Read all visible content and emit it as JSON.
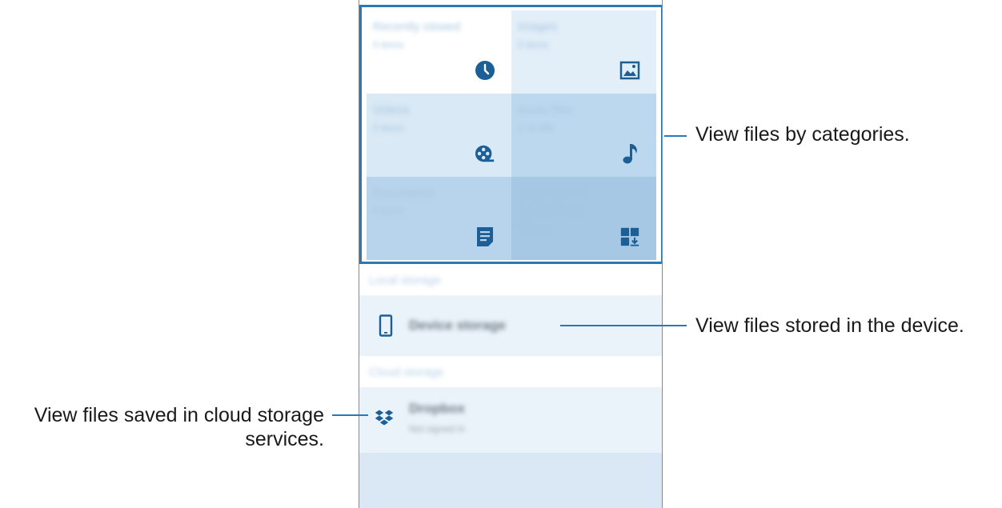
{
  "categories": [
    {
      "label": "Recently viewed",
      "sub": "0 items",
      "icon": "clock-icon"
    },
    {
      "label": "Images",
      "sub": "0 items",
      "icon": "image-icon"
    },
    {
      "label": "Videos",
      "sub": "0 items",
      "icon": "video-reel-icon"
    },
    {
      "label": "Audio files",
      "sub": "2.16 MB",
      "icon": "music-note-icon"
    },
    {
      "label": "Documents",
      "sub": "0 items",
      "icon": "document-icon"
    },
    {
      "label": "Downloaded applications",
      "sub": "0 items",
      "icon": "download-app-icon"
    }
  ],
  "local_storage": {
    "header": "Local storage",
    "device": {
      "label": "Device storage",
      "icon": "phone-icon"
    }
  },
  "cloud_storage": {
    "header": "Cloud storage",
    "dropbox": {
      "label": "Dropbox",
      "sub": "Not signed in",
      "icon": "dropbox-icon"
    }
  },
  "callouts": {
    "categories": "View files by categories.",
    "device": "View files stored in the device.",
    "cloud_line1": "View files saved in cloud storage",
    "cloud_line2": "services."
  },
  "colors": {
    "accent": "#2a78b5",
    "icon": "#1c5f96"
  }
}
